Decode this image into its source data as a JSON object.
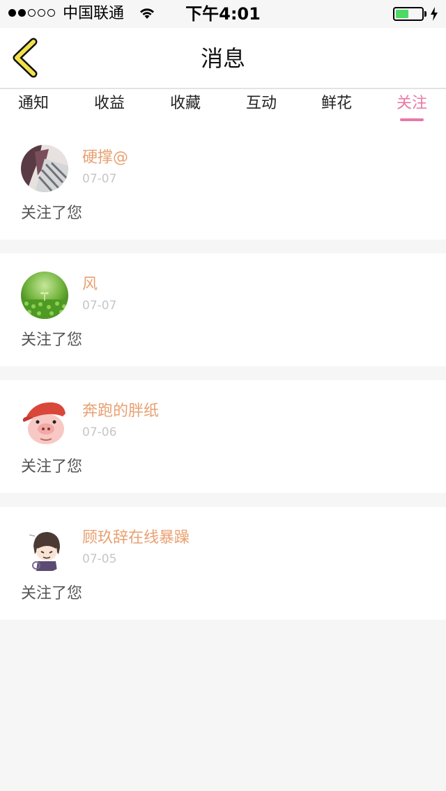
{
  "status_bar": {
    "carrier": "中国联通",
    "time": "下午4:01",
    "signal_bars_filled": 2,
    "signal_bars_total": 5,
    "battery_level": 0.5,
    "battery_color": "#4cd964"
  },
  "nav": {
    "title": "消息",
    "back_icon": "chevron-left-icon",
    "back_icon_color": "#f2e24a"
  },
  "tabs": [
    {
      "label": "通知",
      "active": false
    },
    {
      "label": "收益",
      "active": false
    },
    {
      "label": "收藏",
      "active": false
    },
    {
      "label": "互动",
      "active": false
    },
    {
      "label": "鲜花",
      "active": false
    },
    {
      "label": "关注",
      "active": true
    }
  ],
  "accent_color": "#e879a6",
  "username_color": "#e8a071",
  "notifications": [
    {
      "username": "硬撑@",
      "date": "07-07",
      "message": "关注了您",
      "avatar": "photo-avatar"
    },
    {
      "username": "风",
      "date": "07-07",
      "message": "关注了您",
      "avatar": "green-sprout-avatar"
    },
    {
      "username": "奔跑的胖纸",
      "date": "07-06",
      "message": "关注了您",
      "avatar": "cartoon-pig-avatar"
    },
    {
      "username": "顾玖辞在线暴躁",
      "date": "07-05",
      "message": "关注了您",
      "avatar": "anime-boy-avatar"
    }
  ]
}
